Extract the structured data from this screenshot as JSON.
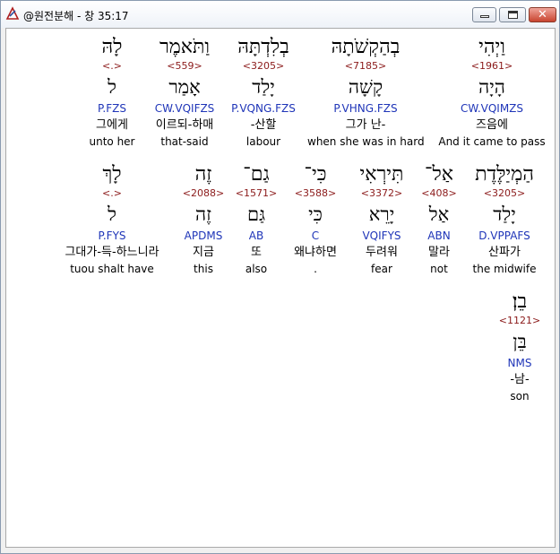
{
  "window": {
    "title": "@원전분해 - 창 35:17",
    "close_glyph": "✕"
  },
  "row1": [
    {
      "heb": "וַיְהִי",
      "num": "<1961>",
      "lex": "הָיָה",
      "code": "CW.VQIMZS",
      "kor": "즈음에",
      "eng": "And it came to pass"
    },
    {
      "heb": "בְהַקְשֹׁתָהּ",
      "num": "<7185>",
      "lex": "קָשָׁה",
      "code": "P.VHNG.FZS",
      "kor": "그가 난-",
      "eng": "when she was in hard"
    },
    {
      "heb": "בְלִדְתָּהּ",
      "num": "<3205>",
      "lex": "יָלַד",
      "code": "P.VQNG.FZS",
      "kor": "-산할",
      "eng": "labour"
    },
    {
      "heb": "וַתֹּאמֶר",
      "num": "<559>",
      "lex": "אָמַר",
      "code": "CW.VQIFZS",
      "kor": "이르되-하매",
      "eng": "that-said"
    },
    {
      "heb": "לָהּ",
      "num": "<.>",
      "lex": "ל",
      "code": "P.FZS",
      "kor": "그에게",
      "eng": "unto her"
    }
  ],
  "row2": [
    {
      "heb": "הַמְיַלֶּדֶת",
      "num": "<3205>",
      "lex": "יָלַד",
      "code": "D.VPPAFS",
      "kor": "산파가",
      "eng": "the midwife"
    },
    {
      "heb": "אַל־",
      "num": "<408>",
      "lex": "אַל",
      "code": "ABN",
      "kor": "말라",
      "eng": "not"
    },
    {
      "heb": "תִּירְאִי",
      "num": "<3372>",
      "lex": "יָרֵא",
      "code": "VQIFYS",
      "kor": "두려워",
      "eng": "fear"
    },
    {
      "heb": "כִּי־",
      "num": "<3588>",
      "lex": "כִּי",
      "code": "C",
      "kor": "왜냐하면",
      "eng": "."
    },
    {
      "heb": "גַם־",
      "num": "<1571>",
      "lex": "גַּם",
      "code": "AB",
      "kor": "또",
      "eng": "also"
    },
    {
      "heb": "זֶה",
      "num": "<2088>",
      "lex": "זֶה",
      "code": "APDMS",
      "kor": "지금",
      "eng": "this"
    },
    {
      "heb": "לָךְ",
      "num": "<.>",
      "lex": "ל",
      "code": "P.FYS",
      "kor": "그대가-득-하느니라",
      "eng": "tuou shalt have"
    }
  ],
  "row3": [
    {
      "heb": "בֵן׃",
      "num": "<1121>",
      "lex": "בֵּן",
      "code": "NMS",
      "kor": "-남-",
      "eng": "son"
    }
  ]
}
